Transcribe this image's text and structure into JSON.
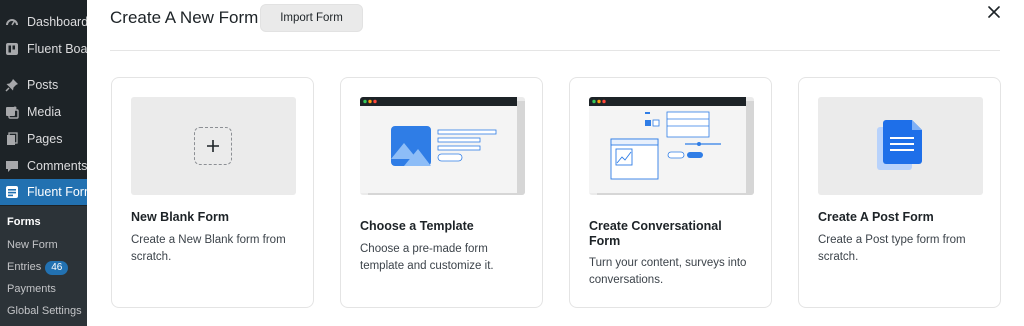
{
  "sidebar": {
    "items": [
      {
        "label": "Dashboard",
        "icon": "dashboard-icon"
      },
      {
        "label": "Fluent Boards",
        "icon": "fluent-boards-icon"
      },
      {
        "label": "Posts",
        "icon": "pin-icon"
      },
      {
        "label": "Media",
        "icon": "media-icon"
      },
      {
        "label": "Pages",
        "icon": "pages-icon"
      },
      {
        "label": "Comments",
        "icon": "comments-icon"
      },
      {
        "label": "Fluent Forms",
        "icon": "fluent-forms-icon"
      }
    ],
    "submenu": {
      "forms": "Forms",
      "new_form": "New Form",
      "entries": "Entries",
      "entries_count": "46",
      "payments": "Payments",
      "global_settings": "Global Settings"
    }
  },
  "modal": {
    "title": "Create A New Form",
    "import_label": "Import Form",
    "close_icon": "close-icon"
  },
  "cards": [
    {
      "title": "New Blank Form",
      "description": "Create a New Blank form from scratch."
    },
    {
      "title": "Choose a Template",
      "description": "Choose a pre-made form template and customize it."
    },
    {
      "title": "Create Conversational Form",
      "description": "Turn your content, surveys into conversations."
    },
    {
      "title": "Create A Post Form",
      "description": "Create a Post type form from scratch."
    }
  ],
  "colors": {
    "sidebar_bg": "#1d2327",
    "active_blue": "#2271b1",
    "illustration_blue": "#2f7de6",
    "doc_blue": "#1e6fe9"
  }
}
